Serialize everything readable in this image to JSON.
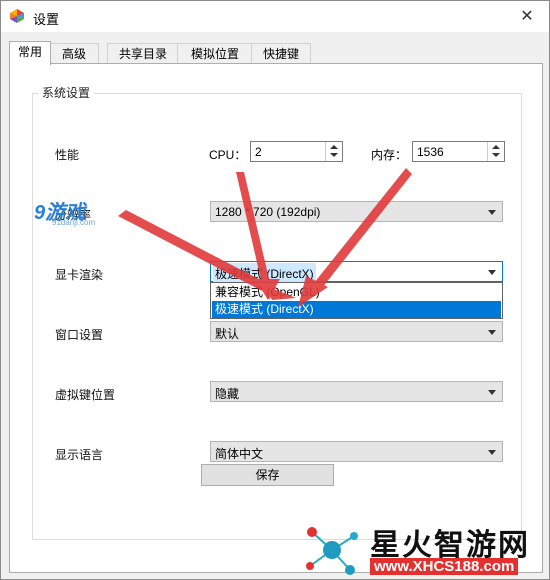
{
  "window": {
    "title": "设置",
    "close_glyph": "✕"
  },
  "tabs": [
    {
      "label": "常用",
      "active": true
    },
    {
      "label": "高级"
    },
    {
      "label": "共享目录"
    },
    {
      "label": "模拟位置"
    },
    {
      "label": "快捷键"
    }
  ],
  "group": {
    "label": "系统设置"
  },
  "performance": {
    "label": "性能",
    "cpu_label": "CPU：",
    "cpu_value": "2",
    "mem_label": "内存：",
    "mem_value": "1536"
  },
  "resolution": {
    "label": "分辨率",
    "value": "1280 * 720 (192dpi)"
  },
  "renderer": {
    "label": "显卡渲染",
    "value": "极速模式 (DirectX)",
    "options": [
      "兼容模式 (OpenGL)",
      "极速模式 (DirectX)"
    ]
  },
  "window_setting": {
    "label": "窗口设置",
    "value": "默认"
  },
  "vkey_position": {
    "label": "虚拟键位置",
    "value": "隐藏"
  },
  "language": {
    "label": "显示语言",
    "value": "简体中文"
  },
  "save_label": "保存",
  "watermarks": {
    "left": {
      "text": "9游戏",
      "sub": "91danji.com"
    },
    "bottom_right": {
      "text": "星火智游网",
      "url": "www.XHCS188.com"
    }
  },
  "colors": {
    "accent": "#0078d7",
    "annotation_arrow": "#e03a3a"
  }
}
